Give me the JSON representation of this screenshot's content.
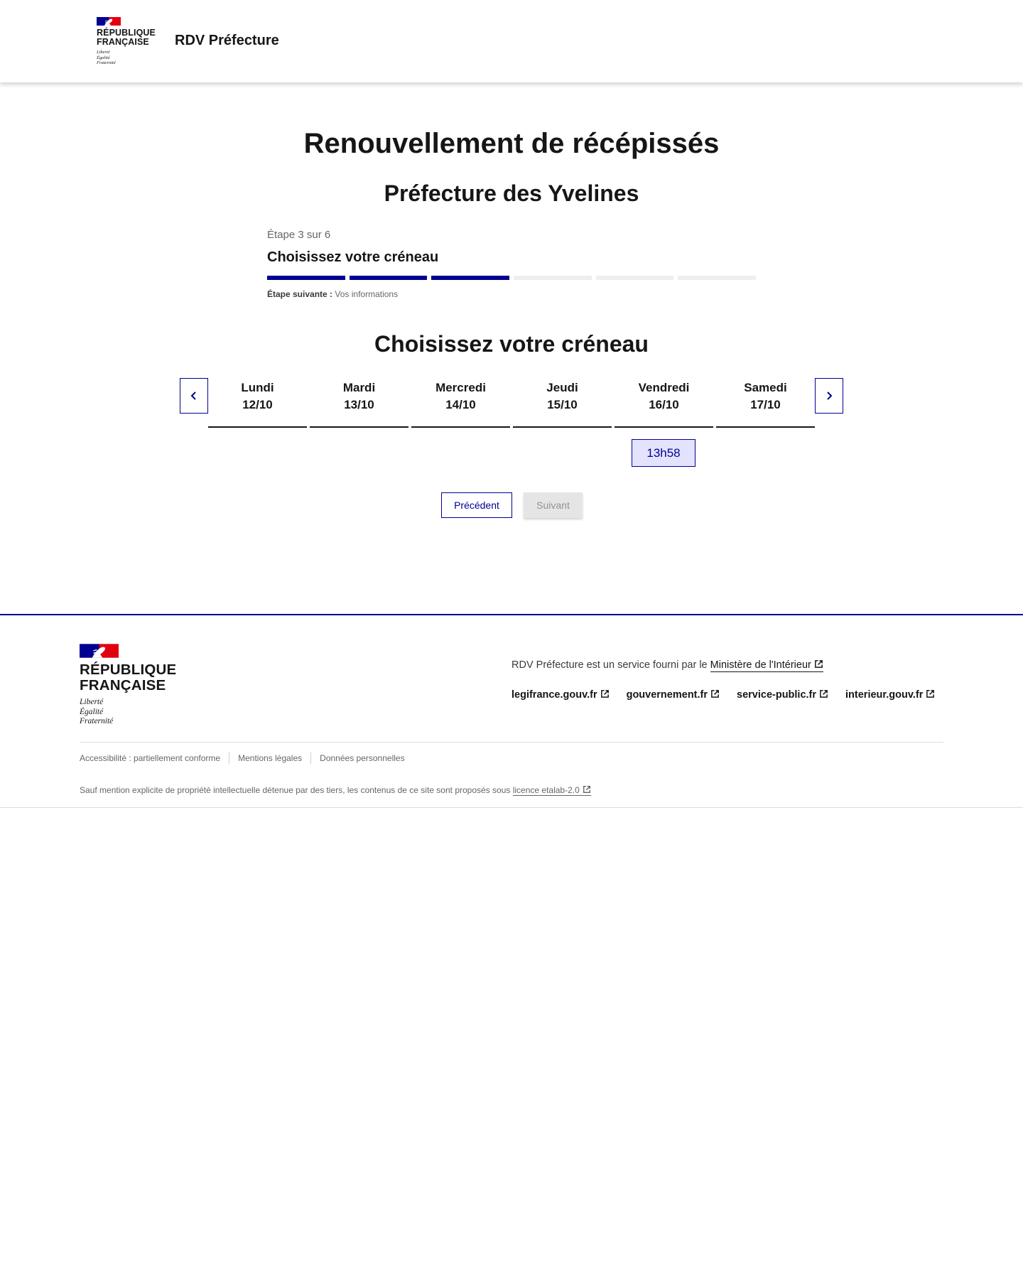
{
  "header": {
    "marianne": "RÉPUBLIQUE\nFRANÇAISE",
    "devise": "Liberté\nÉgalité\nFraternité",
    "service_name": "RDV Préfecture"
  },
  "main": {
    "title": "Renouvellement de récépissés",
    "subtitle": "Préfecture des Yvelines",
    "stepper": {
      "state": "Étape 3 sur 6",
      "current_step": "Choisissez votre créneau",
      "steps_total": 6,
      "steps_done": 3,
      "next_label": "Étape suivante :",
      "next_step": "Vos informations"
    },
    "section_title": "Choisissez votre créneau",
    "days": [
      {
        "name": "Lundi",
        "date": "12/10"
      },
      {
        "name": "Mardi",
        "date": "13/10"
      },
      {
        "name": "Mercredi",
        "date": "14/10"
      },
      {
        "name": "Jeudi",
        "date": "15/10"
      },
      {
        "name": "Vendredi",
        "date": "16/10"
      },
      {
        "name": "Samedi",
        "date": "17/10"
      }
    ],
    "slot": "13h58",
    "btn_previous": "Précédent",
    "btn_next": "Suivant"
  },
  "footer": {
    "marianne": "RÉPUBLIQUE\nFRANÇAISE",
    "devise": "Liberté\nÉgalité\nFraternité",
    "desc_prefix": "RDV Préfecture est un service fourni par le",
    "desc_link": "Ministère de l'Intérieur",
    "links": [
      "legifrance.gouv.fr",
      "gouvernement.fr",
      "service-public.fr",
      "interieur.gouv.fr"
    ],
    "bottom_links": [
      "Accessibilité : partiellement conforme",
      "Mentions légales",
      "Données personnelles"
    ],
    "copyright_prefix": "Sauf mention explicite de propriété intellectuelle détenue par des tiers, les contenus de ce site sont proposés sous",
    "copyright_link": "licence etalab-2.0"
  },
  "colors": {
    "primary": "#000091",
    "flag_red": "#e1000f",
    "slot_bg": "#e3e3fd",
    "disabled_bg": "#e5e5e5"
  }
}
